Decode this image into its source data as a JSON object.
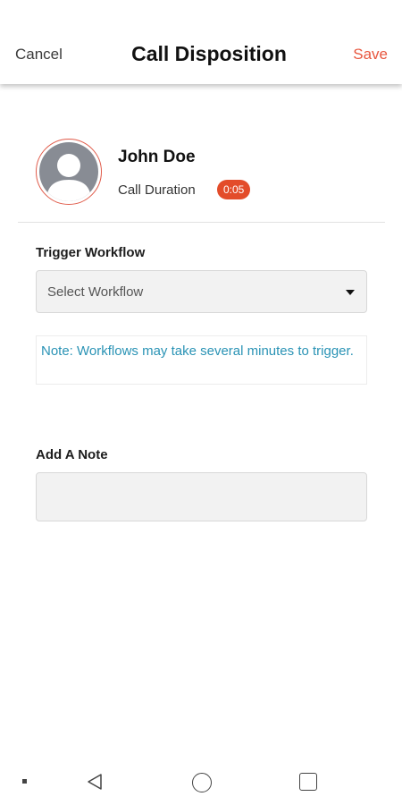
{
  "header": {
    "cancel_label": "Cancel",
    "title": "Call Disposition",
    "save_label": "Save"
  },
  "contact": {
    "name": "John Doe",
    "duration_label": "Call Duration",
    "duration_value": "0:05"
  },
  "workflow": {
    "label": "Trigger Workflow",
    "select_placeholder": "Select Workflow",
    "note": "Note: Workflows may take several minutes to trigger."
  },
  "note_section": {
    "label": "Add A Note",
    "value": ""
  },
  "colors": {
    "accent": "#e8573f",
    "badge": "#e34c2a",
    "info_text": "#2a93b5",
    "avatar": "#888c94"
  },
  "icons": {
    "avatar": "person-silhouette-icon",
    "dropdown": "caret-down-icon",
    "nav_back": "triangle-back-icon",
    "nav_home": "circle-home-icon",
    "nav_recents": "square-recents-icon"
  }
}
